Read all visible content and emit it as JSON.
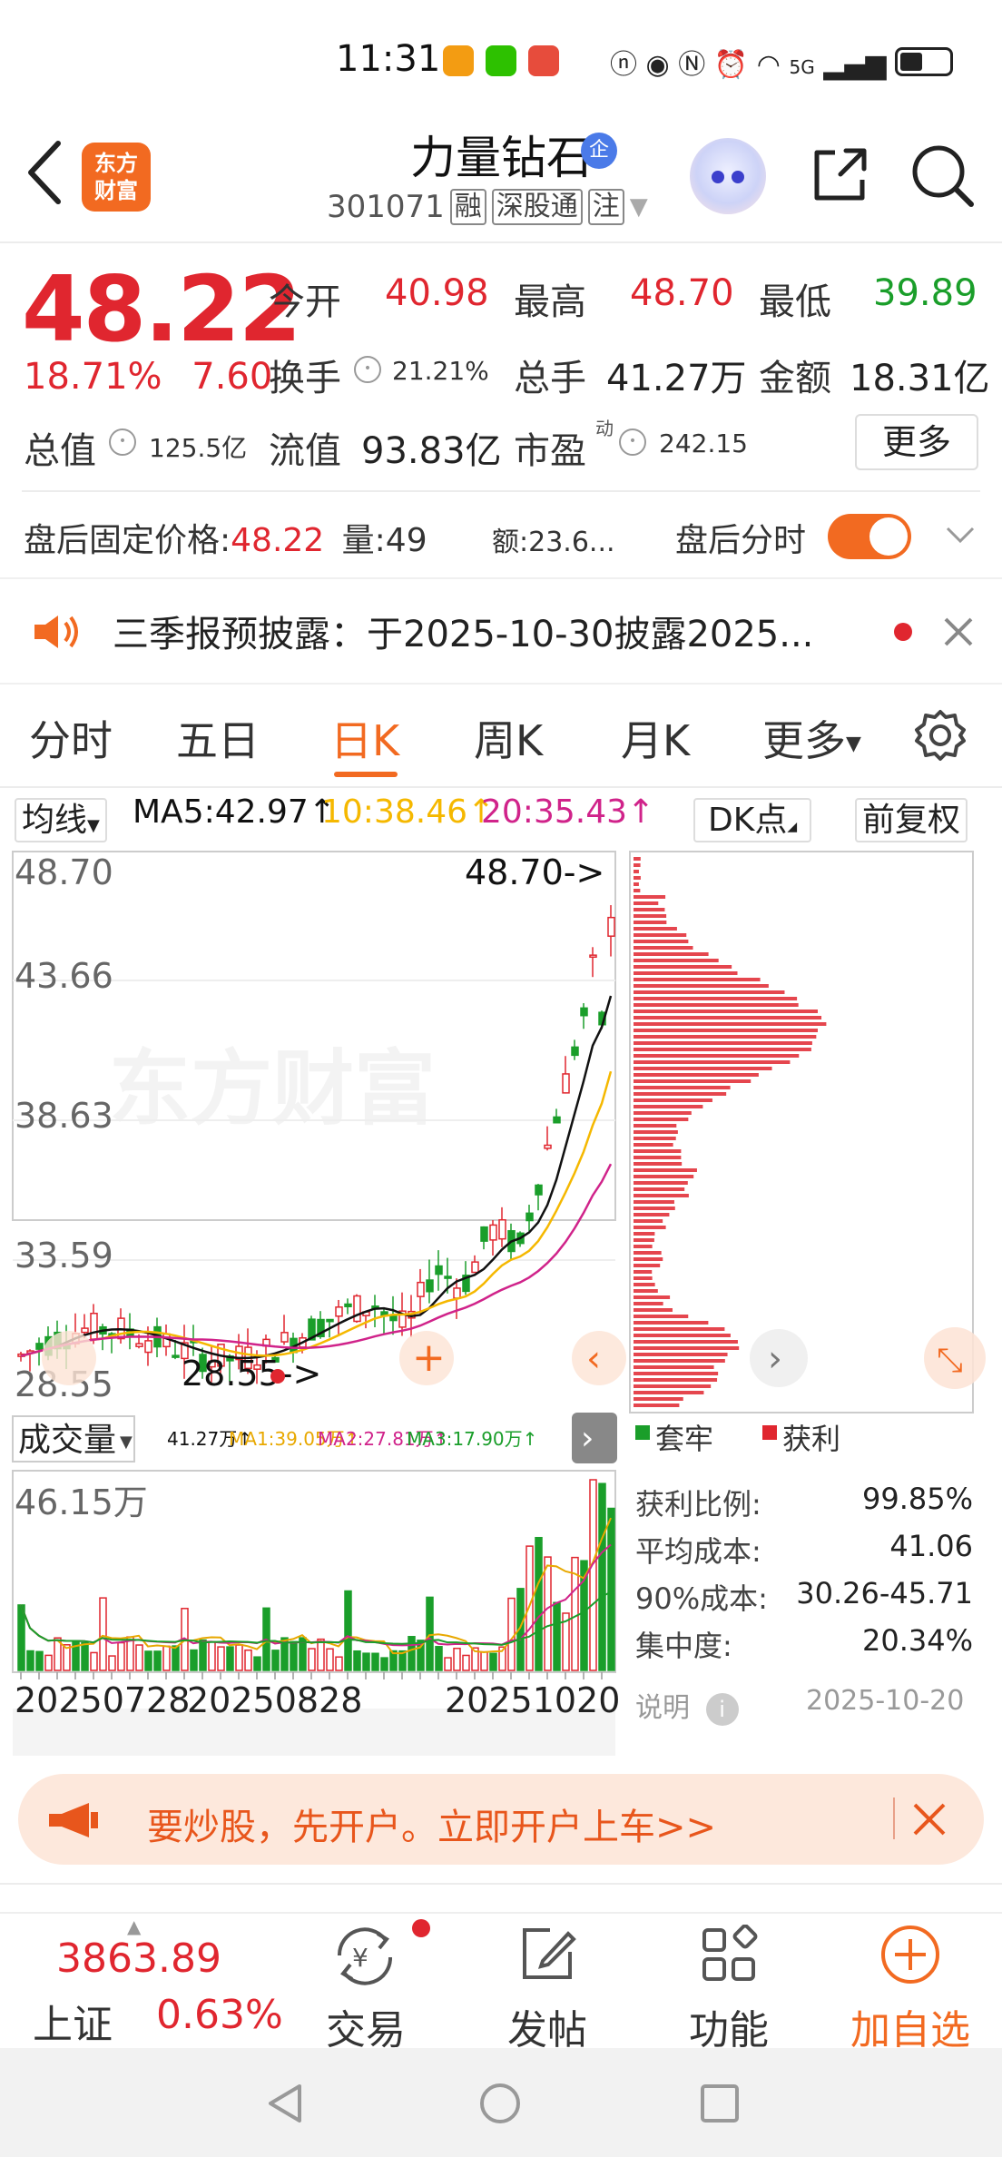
{
  "status_bar": {
    "time": "11:31",
    "network": "5G"
  },
  "header": {
    "logo_line1": "东方",
    "logo_line2": "财富",
    "stock_name": "力量钻石",
    "badge": "企",
    "code": "301071",
    "tags": [
      "融",
      "深股通",
      "注"
    ]
  },
  "quote": {
    "price": "48.22",
    "change_pct": "18.71%",
    "change_amt": "7.60",
    "open_label": "今开",
    "open": "40.98",
    "high_label": "最高",
    "high": "48.70",
    "low_label": "最低",
    "low": "39.89",
    "turnover_label": "换手",
    "turnover": "21.21%",
    "volume_label": "总手",
    "volume": "41.27万",
    "amount_label": "金额",
    "amount": "18.31亿",
    "mktcap_label": "总值",
    "mktcap": "125.5亿",
    "float_label": "流值",
    "float": "93.83亿",
    "pe_label": "市盈",
    "pe_sup": "动",
    "pe": "242.15",
    "more_label": "更多"
  },
  "after_hours": {
    "price_label": "盘后固定价格:",
    "price": "48.22",
    "vol_label": "量:",
    "vol": "49",
    "amt_label": "额:",
    "amt": "23.6...",
    "toggle_label": "盘后分时",
    "toggle_on": true
  },
  "notice": {
    "text": "三季报预披露：于2025-10-30披露2025..."
  },
  "tabs": [
    {
      "label": "分时",
      "active": false
    },
    {
      "label": "五日",
      "active": false
    },
    {
      "label": "日K",
      "active": true
    },
    {
      "label": "周K",
      "active": false
    },
    {
      "label": "月K",
      "active": false
    },
    {
      "label": "更多",
      "active": false
    }
  ],
  "ma_row": {
    "selector": "均线",
    "ma5": "MA5:42.97↑",
    "ma10": "10:38.46↑",
    "ma20": "20:35.43↑",
    "dk": "DK点",
    "adjust": "前复权"
  },
  "kline": {
    "price_ticks": [
      "48.70",
      "43.66",
      "38.63",
      "33.59",
      "28.55"
    ],
    "max_marker": "48.70->",
    "min_marker": "28.55->",
    "watermark": "东方财富",
    "volume_selector": "成交量",
    "volume_legend": {
      "vol": "41.27万↑",
      "ma1": "MA1:39.05万↑",
      "ma2": "MA2:27.81万↑",
      "ma3": "MA3:17.90万↑"
    },
    "volume_max": "46.15万",
    "dates": [
      "20250728",
      "20250828",
      "20251020"
    ]
  },
  "chip": {
    "legend_trapped": "套牢",
    "legend_profit": "获利",
    "rows": [
      {
        "label": "获利比例:",
        "value": "99.85%"
      },
      {
        "label": "平均成本:",
        "value": "41.06"
      },
      {
        "label": "90%成本:",
        "value": "30.26-45.71"
      },
      {
        "label": "集中度:",
        "value": "20.34%"
      }
    ],
    "note_label": "说明",
    "date": "2025-10-20"
  },
  "banner": {
    "text": "要炒股，先开户。立即开户上车>>"
  },
  "bottom": {
    "index_value": "3863.89",
    "index_name": "上证",
    "index_change": "0.63%",
    "items": [
      "交易",
      "发帖",
      "功能",
      "加自选"
    ]
  },
  "colors": {
    "up": "#e0262f",
    "down": "#1a9e2a",
    "accent": "#f26a21",
    "ma5": "#111111",
    "ma10": "#f5b800",
    "ma20": "#d0238a"
  }
}
